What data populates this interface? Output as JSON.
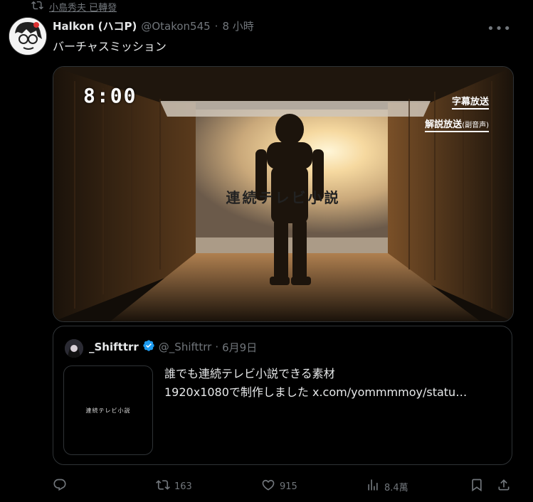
{
  "repost_banner": {
    "text": "小島秀夫 已轉發"
  },
  "tweet": {
    "author_name": "Halkon (ハコP)",
    "handle": "@Otakon545",
    "separator": "·",
    "time": "8 小時",
    "text": "バーチャスミッション",
    "video": {
      "clock": "8:00",
      "badge_subtitles": "字幕放送",
      "badge_commentary": "解説放送",
      "badge_commentary_sub": "(副音声)",
      "center_title": "連続テレビ小説"
    }
  },
  "quoted_tweet": {
    "author_name": "_Shifttrr",
    "handle": "@_Shifttrr",
    "separator": "·",
    "date": "6月9日",
    "text_line1": "誰でも連続テレビ小説できる素材",
    "text_line2": "1920x1080で制作しました  x.com/yommmmoy/statu…",
    "thumbnail_text": "連続テレビ小説"
  },
  "actions": {
    "reposts": "163",
    "likes": "915",
    "views": "8.4萬"
  },
  "colors": {
    "verified": "#1d9bf0",
    "muted": "#71767b"
  }
}
